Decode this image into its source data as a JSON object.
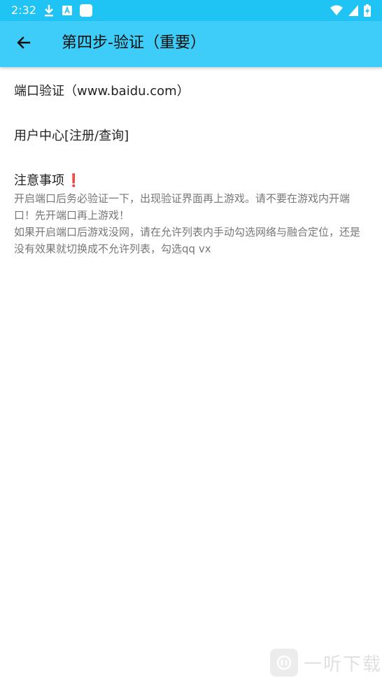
{
  "status_bar": {
    "time": "2:32",
    "left_icons": [
      "download-icon",
      "keyboard-icon",
      "app-icon"
    ],
    "right_icons": [
      "wifi-icon",
      "signal-icon",
      "battery-charging-icon"
    ]
  },
  "app_bar": {
    "title": "第四步-验证（重要）",
    "back_icon": "arrow-left-icon"
  },
  "items": {
    "port_verify": "端口验证（www.baidu.com）",
    "user_center": "用户中心[注册/查询]"
  },
  "notice": {
    "title": "注意事项",
    "mark": "❗",
    "line1": "开启端口后务必验证一下，出现验证界面再上游戏。请不要在游戏内开端口！先开端口再上游戏！",
    "line2": "如果开启端口后游戏没网，请在允许列表内手动勾选网络与融合定位，还是没有效果就切换成不允许列表，勾选qq vx"
  },
  "watermark": {
    "text": "一听下载"
  },
  "colors": {
    "status_bar": "#1fc4f4",
    "app_bar": "#3ecdf8",
    "text_primary": "#222222",
    "text_secondary": "#777777",
    "notice_mark": "#e53935"
  }
}
